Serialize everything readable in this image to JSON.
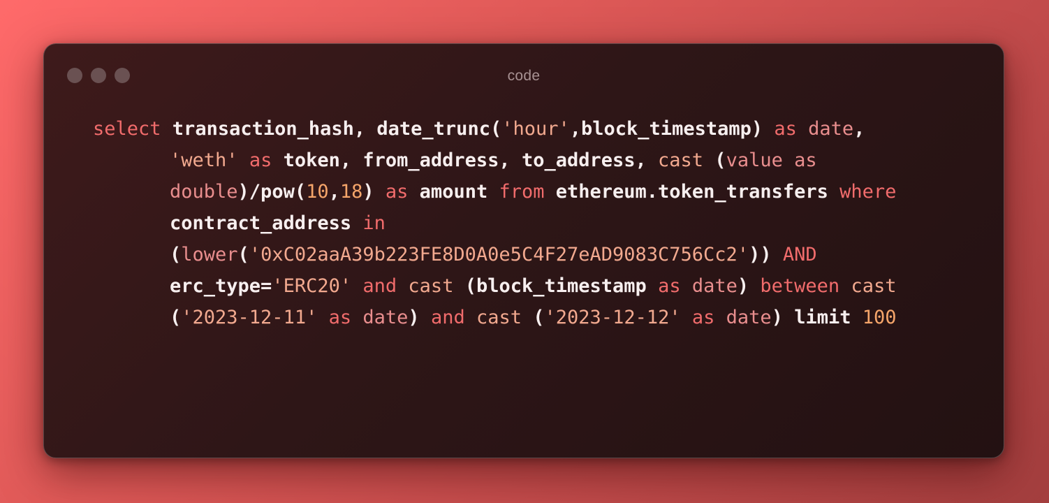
{
  "window": {
    "title": "code"
  },
  "code_lines": [
    [
      {
        "t": "select",
        "c": "kw"
      },
      {
        "t": " transaction_hash, date_trunc(",
        "c": "pl"
      },
      {
        "t": "'hour'",
        "c": "str"
      },
      {
        "t": ",block_timestamp) ",
        "c": "pl"
      },
      {
        "t": "as",
        "c": "kw"
      },
      {
        "t": " ",
        "c": "pl"
      },
      {
        "t": "date",
        "c": "fn"
      },
      {
        "t": ",",
        "c": "pl"
      }
    ],
    [
      {
        "t": "'weth'",
        "c": "str"
      },
      {
        "t": " ",
        "c": "pl"
      },
      {
        "t": "as",
        "c": "kw"
      },
      {
        "t": " token, from_address, to_address, ",
        "c": "pl"
      },
      {
        "t": "cast",
        "c": "str"
      },
      {
        "t": " (",
        "c": "pl"
      },
      {
        "t": "value",
        "c": "fn"
      },
      {
        "t": " ",
        "c": "pl"
      },
      {
        "t": "as",
        "c": "fn"
      }
    ],
    [
      {
        "t": "double",
        "c": "fn"
      },
      {
        "t": ")/pow(",
        "c": "pl"
      },
      {
        "t": "10",
        "c": "num"
      },
      {
        "t": ",",
        "c": "pl"
      },
      {
        "t": "18",
        "c": "num"
      },
      {
        "t": ") ",
        "c": "pl"
      },
      {
        "t": "as",
        "c": "kw"
      },
      {
        "t": " amount ",
        "c": "pl"
      },
      {
        "t": "from",
        "c": "kw"
      },
      {
        "t": " ethereum.token_transfers ",
        "c": "pl"
      },
      {
        "t": "where",
        "c": "kw"
      }
    ],
    [
      {
        "t": "contract_address ",
        "c": "pl"
      },
      {
        "t": "in",
        "c": "kw"
      }
    ],
    [
      {
        "t": "(",
        "c": "pl"
      },
      {
        "t": "lower",
        "c": "fn"
      },
      {
        "t": "(",
        "c": "pl"
      },
      {
        "t": "'0xC02aaA39b223FE8D0A0e5C4F27eAD9083C756Cc2'",
        "c": "str"
      },
      {
        "t": ")) ",
        "c": "pl"
      },
      {
        "t": "AND",
        "c": "kw"
      }
    ],
    [
      {
        "t": "erc_type=",
        "c": "pl"
      },
      {
        "t": "'ERC20'",
        "c": "str"
      },
      {
        "t": " ",
        "c": "pl"
      },
      {
        "t": "and",
        "c": "kw"
      },
      {
        "t": " ",
        "c": "pl"
      },
      {
        "t": "cast",
        "c": "str"
      },
      {
        "t": " (block_timestamp ",
        "c": "pl"
      },
      {
        "t": "as",
        "c": "kw"
      },
      {
        "t": " ",
        "c": "pl"
      },
      {
        "t": "date",
        "c": "fn"
      },
      {
        "t": ") ",
        "c": "pl"
      },
      {
        "t": "between",
        "c": "kw"
      },
      {
        "t": " ",
        "c": "pl"
      },
      {
        "t": "cast",
        "c": "str"
      }
    ],
    [
      {
        "t": "(",
        "c": "pl"
      },
      {
        "t": "'2023-12-11'",
        "c": "str"
      },
      {
        "t": " ",
        "c": "pl"
      },
      {
        "t": "as",
        "c": "kw"
      },
      {
        "t": " ",
        "c": "pl"
      },
      {
        "t": "date",
        "c": "fn"
      },
      {
        "t": ") ",
        "c": "pl"
      },
      {
        "t": "and",
        "c": "kw"
      },
      {
        "t": " ",
        "c": "pl"
      },
      {
        "t": "cast",
        "c": "str"
      },
      {
        "t": " (",
        "c": "pl"
      },
      {
        "t": "'2023-12-12'",
        "c": "str"
      },
      {
        "t": " ",
        "c": "pl"
      },
      {
        "t": "as",
        "c": "kw"
      },
      {
        "t": " ",
        "c": "pl"
      },
      {
        "t": "date",
        "c": "fn"
      },
      {
        "t": ") limit ",
        "c": "pl"
      },
      {
        "t": "100",
        "c": "num"
      }
    ]
  ],
  "colors": {
    "keyword": "#f16c6c",
    "function": "#e98e8e",
    "string": "#f2a98f",
    "number": "#f5a56a",
    "plain": "#f7efef",
    "window_bg": "#2e1617",
    "window_dots": "#6a5152"
  }
}
